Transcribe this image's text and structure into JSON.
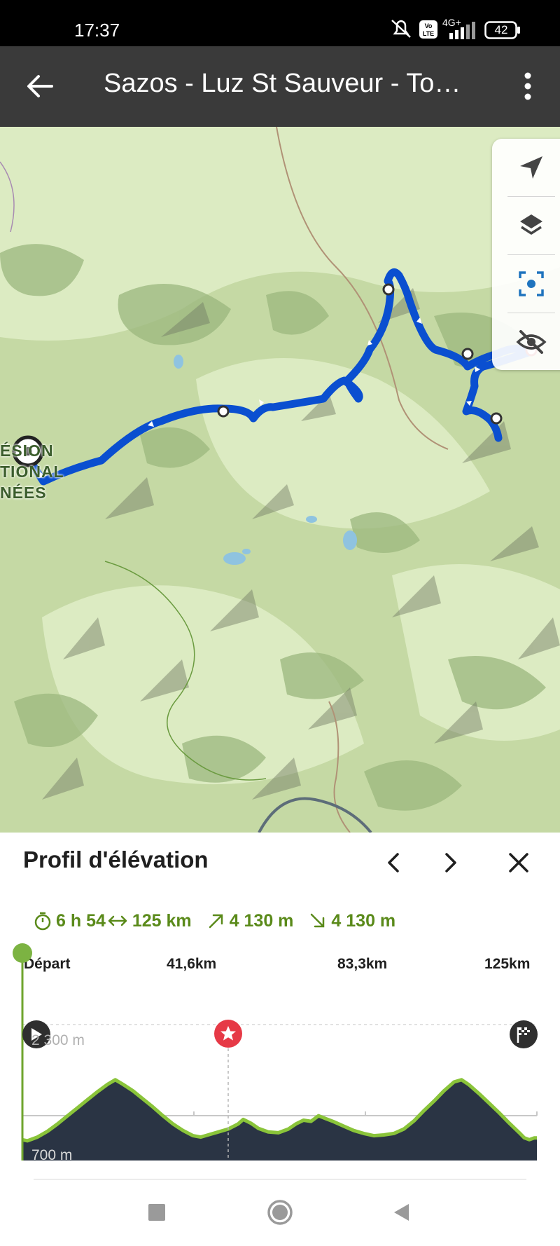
{
  "status": {
    "time": "17:37",
    "network": "4G+",
    "battery": "42",
    "volte": "Vo LTE"
  },
  "appbar": {
    "title": "Sazos - Luz St Sauveur - Tour…"
  },
  "map": {
    "area_label_lines": [
      "ÉSION",
      "TIONAL",
      "NÉES"
    ]
  },
  "elevation": {
    "title": "Profil d'élévation",
    "stats": {
      "duration": "6 h 54",
      "distance": "125 km",
      "ascent": "4 130 m",
      "descent": "4 130 m"
    },
    "km_labels": [
      "Départ",
      "41,6km",
      "83,3km",
      "125km"
    ],
    "max_label": "2 300 m",
    "min_label": "700 m",
    "profile": [
      [
        0,
        735
      ],
      [
        2,
        720
      ],
      [
        6,
        770
      ],
      [
        10,
        850
      ],
      [
        14,
        950
      ],
      [
        18,
        1060
      ],
      [
        22,
        1170
      ],
      [
        26,
        1280
      ],
      [
        30,
        1390
      ],
      [
        34,
        1490
      ],
      [
        37,
        1550
      ],
      [
        40,
        1490
      ],
      [
        44,
        1400
      ],
      [
        48,
        1290
      ],
      [
        52,
        1180
      ],
      [
        56,
        1060
      ],
      [
        60,
        950
      ],
      [
        64,
        860
      ],
      [
        68,
        790
      ],
      [
        71,
        770
      ],
      [
        74,
        800
      ],
      [
        78,
        840
      ],
      [
        82,
        880
      ],
      [
        86,
        950
      ],
      [
        88,
        1010
      ],
      [
        91,
        960
      ],
      [
        94,
        890
      ],
      [
        98,
        840
      ],
      [
        102,
        830
      ],
      [
        106,
        880
      ],
      [
        109,
        950
      ],
      [
        112,
        1000
      ],
      [
        115,
        985
      ],
      [
        118,
        1060
      ],
      [
        121,
        1020
      ],
      [
        124,
        980
      ],
      [
        128,
        920
      ],
      [
        132,
        860
      ],
      [
        136,
        820
      ],
      [
        140,
        790
      ],
      [
        144,
        800
      ],
      [
        148,
        820
      ],
      [
        152,
        880
      ],
      [
        156,
        990
      ],
      [
        160,
        1130
      ],
      [
        164,
        1260
      ],
      [
        168,
        1400
      ],
      [
        172,
        1520
      ],
      [
        175,
        1550
      ],
      [
        178,
        1480
      ],
      [
        182,
        1360
      ],
      [
        186,
        1230
      ],
      [
        190,
        1100
      ],
      [
        194,
        960
      ],
      [
        198,
        830
      ],
      [
        200,
        760
      ],
      [
        202,
        735
      ],
      [
        204,
        760
      ],
      [
        205,
        760
      ]
    ],
    "profile_x_max": 205,
    "profile_y_min": 700,
    "profile_y_max": 2300,
    "cursor_position": 0.4
  },
  "colors": {
    "route": "#0a4fd0",
    "accent_green": "#5a8a1a",
    "profile_fill": "#2a3444",
    "profile_line": "#8ac43a",
    "marker_red": "#e63946"
  },
  "icons": [
    "back-arrow-icon",
    "more-vert-icon",
    "navigate-icon",
    "layers-icon",
    "focus-route-icon",
    "eye-off-icon",
    "chevron-left-icon",
    "chevron-right-icon",
    "close-icon",
    "timer-icon",
    "distance-icon",
    "ascent-icon",
    "descent-icon",
    "play-icon",
    "star-marker-icon",
    "finish-flag-icon",
    "recent-apps-icon",
    "home-icon",
    "back-icon"
  ]
}
